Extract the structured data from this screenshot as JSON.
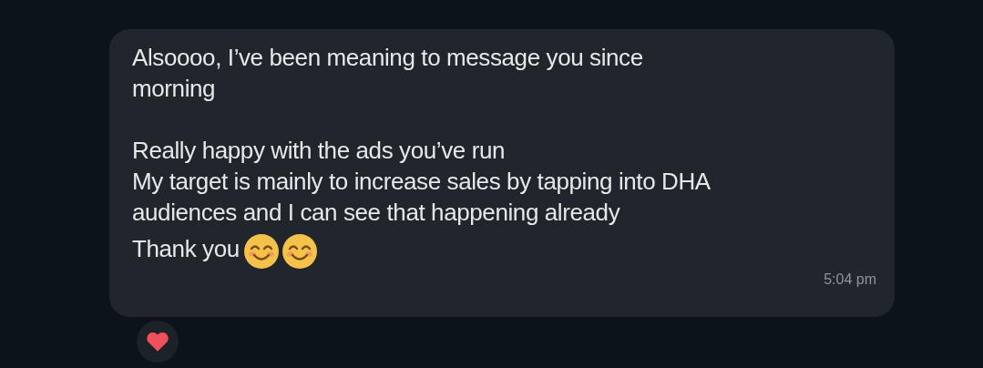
{
  "message": {
    "paragraphs": [
      {
        "lines": [
          "Alsoooo, I’ve been meaning to message you since",
          "morning"
        ]
      },
      {
        "lines": [
          "Really happy with the ads you’ve run",
          "My target is mainly to increase sales by tapping into DHA",
          "audiences and I can see that happening already"
        ]
      }
    ],
    "closing": "Thank you",
    "time": "5:04 pm"
  }
}
